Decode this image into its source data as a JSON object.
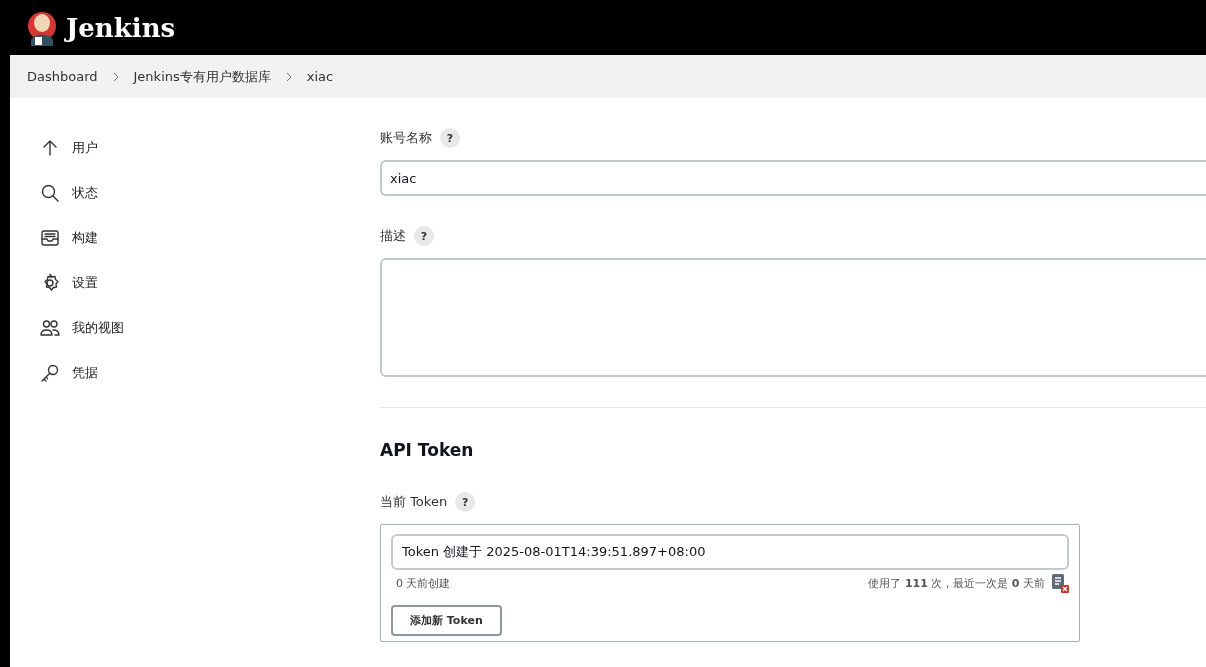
{
  "header": {
    "title": "Jenkins"
  },
  "breadcrumbs": [
    "Dashboard",
    "Jenkins专有用户数据库",
    "xiac"
  ],
  "sidebar": {
    "items": [
      {
        "label": "用户",
        "kind": "up"
      },
      {
        "label": "状态",
        "kind": "search"
      },
      {
        "label": "构建",
        "kind": "inbox"
      },
      {
        "label": "设置",
        "kind": "gear"
      },
      {
        "label": "我的视图",
        "kind": "people"
      },
      {
        "label": "凭据",
        "kind": "key"
      }
    ]
  },
  "form": {
    "account_label": "账号名称",
    "account_help": "?",
    "account_value": "xiac",
    "description_label": "描述",
    "description_help": "?"
  },
  "api_token": {
    "heading": "API Token",
    "current_label": "当前 Token",
    "current_help": "?",
    "token_name": "Token 创建于 2025-08-01T14:39:51.897+08:00",
    "created": "0 天前创建",
    "usage": "使用了 **111** 次，最近一次是 **0** 天前",
    "add_button": "添加新 Token"
  }
}
